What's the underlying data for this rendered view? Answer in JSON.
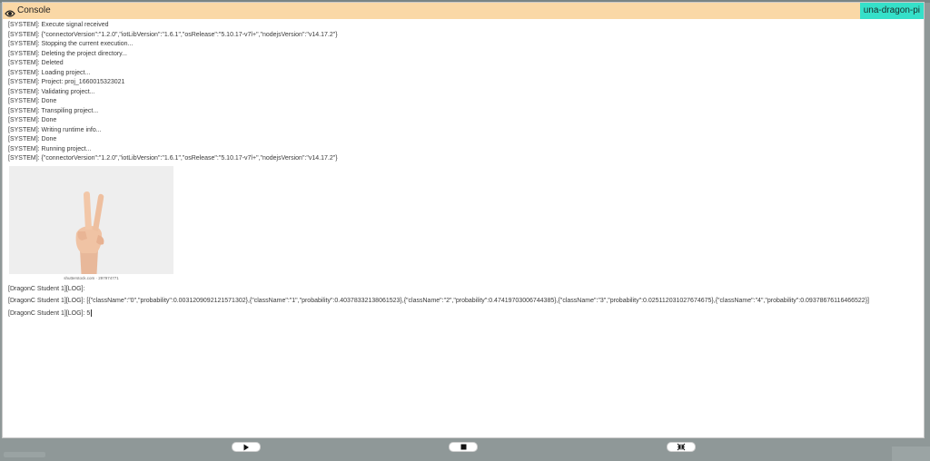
{
  "console": {
    "title": "Console",
    "device": "una-dragon-pi",
    "system_lines": [
      "[SYSTEM]: Execute signal received",
      "[SYSTEM]: {\"connectorVersion\":\"1.2.0\",\"iotLibVersion\":\"1.6.1\",\"osRelease\":\"5.10.17-v7l+\",\"nodejsVersion\":\"v14.17.2\"}",
      "[SYSTEM]: Stopping the current execution...",
      "[SYSTEM]: Deleting the project directory...",
      "[SYSTEM]: Deleted",
      "[SYSTEM]: Loading project...",
      "[SYSTEM]: Project: proj_1660015323021",
      "[SYSTEM]: Validating project...",
      "[SYSTEM]: Done",
      "[SYSTEM]: Transpiling project...",
      "[SYSTEM]: Done",
      "[SYSTEM]: Writing runtime info...",
      "[SYSTEM]: Done",
      "[SYSTEM]: Running project...",
      "[SYSTEM]: {\"connectorVersion\":\"1.2.0\",\"iotLibVersion\":\"1.6.1\",\"osRelease\":\"5.10.17-v7l+\",\"nodejsVersion\":\"v14.17.2\"}"
    ],
    "image_watermark": "shutterstock.com · 297974771",
    "log_lines": [
      "[DragonC Student 1][LOG]:",
      "[DragonC Student 1][LOG]: [{\"className\":\"0\",\"probability\":0.0031209092121571302},{\"className\":\"1\",\"probability\":0.40378332138061523},{\"className\":\"2\",\"probability\":0.47419703006744385},{\"className\":\"3\",\"probability\":0.025112031027674675},{\"className\":\"4\",\"probability\":0.09378676116466522}]",
      "[DragonC Student 1][LOG]: 5"
    ]
  },
  "controls": {
    "play_icon": "play-icon",
    "stop_icon": "stop-icon",
    "collapse_icon": "collapse-icon"
  },
  "colors": {
    "header_bg": "#fad8a6",
    "badge_bg": "#35e0c9",
    "backdrop": "#8f9898"
  }
}
